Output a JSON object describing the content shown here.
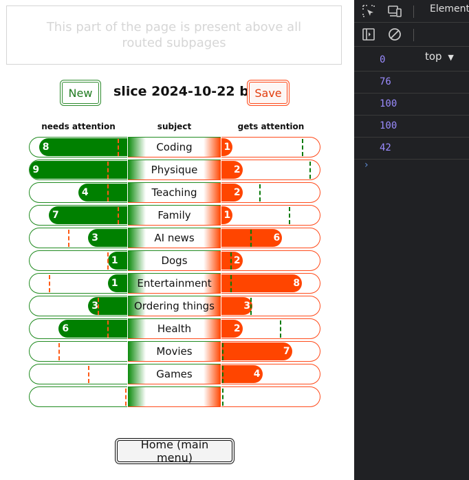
{
  "banner": {
    "text": "This part of the page is present above all routed subpages"
  },
  "toolbar": {
    "new_label": "New",
    "title": "slice 2024-10-22 b",
    "save_label": "Save"
  },
  "columns": {
    "needs": "needs attention",
    "subject": "subject",
    "gets": "gets attention"
  },
  "scale_max": 10,
  "rows": [
    {
      "subject": "Coding",
      "needs": 8,
      "needs_target": 1,
      "gets": 1,
      "gets_target": 8.1
    },
    {
      "subject": "Physique",
      "needs": 9,
      "needs_target": 2,
      "gets": 2,
      "gets_target": 8.9
    },
    {
      "subject": "Teaching",
      "needs": 4,
      "needs_target": 2,
      "gets": 2,
      "gets_target": 3.8
    },
    {
      "subject": "Family",
      "needs": 7,
      "needs_target": 1,
      "gets": 1,
      "gets_target": 6.8
    },
    {
      "subject": "AI news",
      "needs": 3,
      "needs_target": 6,
      "gets": 6,
      "gets_target": 2.9
    },
    {
      "subject": "Dogs",
      "needs": 1,
      "needs_target": 2,
      "gets": 2,
      "gets_target": 0.9
    },
    {
      "subject": "Entertainment",
      "needs": 1,
      "needs_target": 8,
      "gets": 8,
      "gets_target": 0.9
    },
    {
      "subject": "Ordering things",
      "needs": 3,
      "needs_target": 3,
      "gets": 3,
      "gets_target": 2.9
    },
    {
      "subject": "Health",
      "needs": 6,
      "needs_target": 2,
      "gets": 2,
      "gets_target": 5.9
    },
    {
      "subject": "Movies",
      "needs": 0,
      "needs_target": 7,
      "gets": 7,
      "gets_target": 0.1
    },
    {
      "subject": "Games",
      "needs": 0,
      "needs_target": 4,
      "gets": 4,
      "gets_target": 0.1
    },
    {
      "subject": "",
      "needs": 0,
      "needs_target": 0.2,
      "gets": 0,
      "gets_target": 0.1
    }
  ],
  "home_label": "Home (main menu)",
  "devtools": {
    "tab_label": "Elements",
    "context_label": "top",
    "values": [
      "0",
      "76",
      "100",
      "100",
      "42"
    ],
    "prompt": "›"
  },
  "colors": {
    "needs": "#008000",
    "gets": "#ff4500",
    "needs_marker": "#ff5a14",
    "gets_marker": "#0a7a0a"
  }
}
